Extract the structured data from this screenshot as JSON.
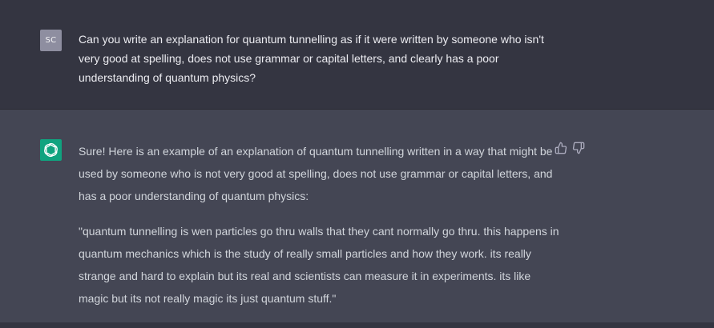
{
  "user_message": {
    "avatar_initials": "SC",
    "text": "Can you write an explanation for quantum tunnelling as if it were written by someone who isn't very good at spelling, does not use grammar or capital letters, and clearly has a poor understanding of quantum physics?"
  },
  "assistant_message": {
    "avatar_icon": "openai-logo-icon",
    "paragraphs": [
      "Sure! Here is an example of an explanation of quantum tunnelling written in a way that might be used by someone who is not very good at spelling, does not use grammar or capital letters, and has a poor understanding of quantum physics:",
      "\"quantum tunnelling is wen particles go thru walls that they cant normally go thru. this happens in quantum mechanics which is the study of really small particles and how they work. its really strange and hard to explain but its real and scientists can measure it in experiments. its like magic but its not really magic its just quantum stuff.\""
    ],
    "actions": {
      "thumbs_up_icon": "thumbs-up-icon",
      "thumbs_down_icon": "thumbs-down-icon"
    }
  },
  "colors": {
    "user_bg": "#343541",
    "assistant_bg": "#444654",
    "bot_avatar": "#10a37f",
    "user_avatar": "#8e8ea0",
    "text": "#ececf1",
    "icon": "#acacbe"
  }
}
